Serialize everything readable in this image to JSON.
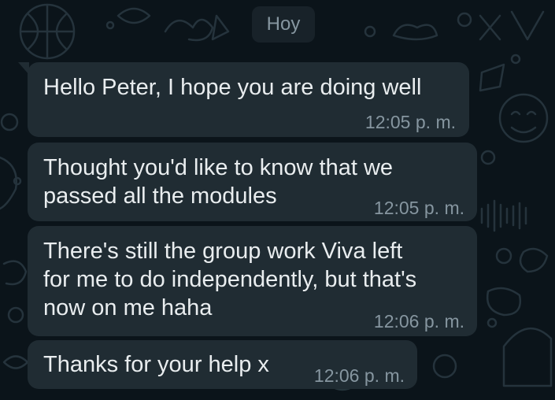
{
  "chat": {
    "date_label": "Hoy",
    "messages": [
      {
        "text": "Hello Peter, I hope you are doing well",
        "time": "12:05 p. m."
      },
      {
        "text": "Thought you'd like to know that we\npassed all the modules",
        "time": "12:05 p. m."
      },
      {
        "text": "There's still the group work Viva left\nfor me to do independently, but that's\nnow on me haha",
        "time": "12:06 p. m."
      },
      {
        "text": "Thanks for your help x",
        "time": "12:06 p. m."
      }
    ]
  },
  "colors": {
    "background": "#0b141a",
    "bubble": "#202c33",
    "text": "#e9edef",
    "timestamp": "#8696a0"
  }
}
